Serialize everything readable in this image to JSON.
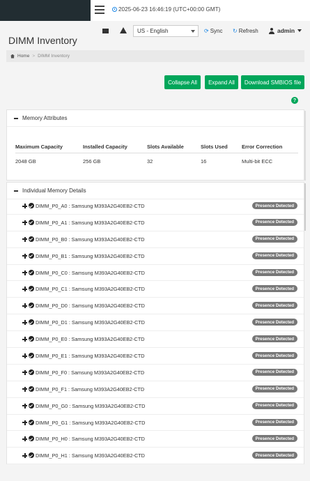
{
  "topbar": {
    "datetime": "2025-06-23 16:46:19 (UTC+00:00 GMT)"
  },
  "header": {
    "language": "US - English",
    "sync_label": "Sync",
    "refresh_label": "Refresh",
    "user_label": "admin"
  },
  "page": {
    "title": "DIMM Inventory"
  },
  "breadcrumb": {
    "home": "Home",
    "separator": ">",
    "current": "DIMM Inventory"
  },
  "actions": {
    "collapse_all": "Collapse All",
    "expand_all": "Expand All",
    "download_smbios": "Download SMBIOS file"
  },
  "memory_attributes": {
    "title": "Memory Attributes",
    "headers": [
      "Maximum Capacity",
      "Installed Capacity",
      "Slots Available",
      "Slots Used",
      "Error Correction"
    ],
    "row": [
      "2048 GB",
      "256 GB",
      "32",
      "16",
      "Multi-bit ECC"
    ]
  },
  "dimm_details": {
    "title": "Individual Memory Details",
    "status_label": "Presence Detected",
    "items": [
      "DIMM_P0_A0 : Samsung M393A2G40EB2-CTD",
      "DIMM_P0_A1 : Samsung M393A2G40EB2-CTD",
      "DIMM_P0_B0 : Samsung M393A2G40EB2-CTD",
      "DIMM_P0_B1 : Samsung M393A2G40EB2-CTD",
      "DIMM_P0_C0 : Samsung M393A2G40EB2-CTD",
      "DIMM_P0_C1 : Samsung M393A2G40EB2-CTD",
      "DIMM_P0_D0 : Samsung M393A2G40EB2-CTD",
      "DIMM_P0_D1 : Samsung M393A2G40EB2-CTD",
      "DIMM_P0_E0 : Samsung M393A2G40EB2-CTD",
      "DIMM_P0_E1 : Samsung M393A2G40EB2-CTD",
      "DIMM_P0_F0 : Samsung M393A2G40EB2-CTD",
      "DIMM_P0_F1 : Samsung M393A2G40EB2-CTD",
      "DIMM_P0_G0 : Samsung M393A2G40EB2-CTD",
      "DIMM_P0_G1 : Samsung M393A2G40EB2-CTD",
      "DIMM_P0_H0 : Samsung M393A2G40EB2-CTD",
      "DIMM_P0_H1 : Samsung M393A2G40EB2-CTD"
    ]
  },
  "colors": {
    "accent_green": "#00a65a",
    "sidebar_dark": "#222d32",
    "badge_gray": "#777777",
    "link_blue": "#1e88e5"
  },
  "icons": [
    "menu-icon",
    "clock-icon",
    "envelope-icon",
    "warning-icon",
    "sync-icon",
    "refresh-icon",
    "user-icon",
    "home-icon",
    "help-icon",
    "minus-icon",
    "plus-icon",
    "check-circle-icon"
  ]
}
